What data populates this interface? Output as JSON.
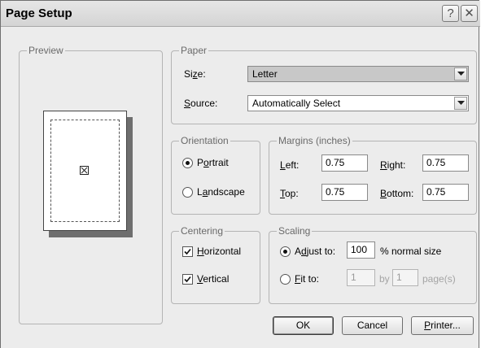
{
  "window": {
    "title": "Page Setup",
    "help_glyph": "?",
    "close_glyph": "✕"
  },
  "preview": {
    "legend": "Preview"
  },
  "paper": {
    "legend": "Paper",
    "size_label": {
      "pre": "Si",
      "key": "z",
      "post": "e:"
    },
    "size_value": "Letter",
    "source_label": {
      "pre": "",
      "key": "S",
      "post": "ource:"
    },
    "source_value": "Automatically Select"
  },
  "orientation": {
    "legend": "Orientation",
    "portrait": {
      "pre": "P",
      "key": "o",
      "post": "rtrait",
      "selected": true
    },
    "landscape": {
      "pre": "L",
      "key": "a",
      "post": "ndscape",
      "selected": false
    }
  },
  "margins": {
    "legend": "Margins (inches)",
    "left": {
      "pre": "",
      "key": "L",
      "post": "eft:",
      "value": "0.75"
    },
    "right": {
      "pre": "",
      "key": "R",
      "post": "ight:",
      "value": "0.75"
    },
    "top": {
      "pre": "",
      "key": "T",
      "post": "op:",
      "value": "0.75"
    },
    "bottom": {
      "pre": "",
      "key": "B",
      "post": "ottom:",
      "value": "0.75"
    }
  },
  "centering": {
    "legend": "Centering",
    "horizontal": {
      "pre": "",
      "key": "H",
      "post": "orizontal",
      "checked": true
    },
    "vertical": {
      "pre": "",
      "key": "V",
      "post": "ertical",
      "checked": true
    }
  },
  "scaling": {
    "legend": "Scaling",
    "adjust": {
      "pre": "A",
      "key": "d",
      "post": "just to:",
      "selected": true,
      "value": "100",
      "suffix": "% normal size"
    },
    "fit": {
      "pre": "",
      "key": "F",
      "post": "it to:",
      "selected": false,
      "wide": "1",
      "by": "by",
      "tall": "1",
      "suffix": "page(s)"
    }
  },
  "buttons": {
    "ok": {
      "pre": "OK",
      "key": "",
      "post": ""
    },
    "cancel": {
      "pre": "Cancel",
      "key": "",
      "post": ""
    },
    "printer": {
      "pre": "",
      "key": "P",
      "post": "rinter..."
    }
  }
}
